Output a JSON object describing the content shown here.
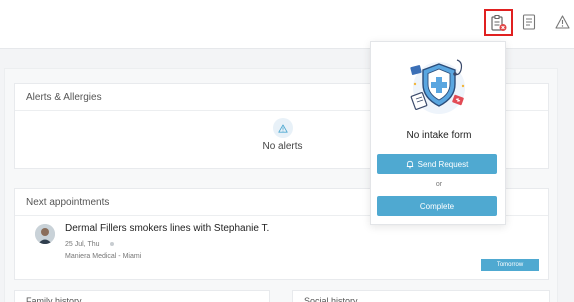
{
  "topbar": {
    "icons": [
      "intake-form-icon",
      "notes-icon",
      "warning-icon"
    ]
  },
  "alerts": {
    "title": "Alerts & Allergies",
    "empty_text": "No alerts"
  },
  "appointments": {
    "title": "Next appointments",
    "item": {
      "title": "Dermal Fillers smokers lines with Stephanie T.",
      "date": "25 Jul, Thu",
      "location": "Maniera Medical - Miami",
      "badge": "Tomorrow"
    }
  },
  "family_history": {
    "title": "Family history"
  },
  "social_history": {
    "title": "Social history"
  },
  "intake_popup": {
    "title": "No intake form",
    "send_label": "Send Request",
    "or_label": "or",
    "complete_label": "Complete"
  },
  "colors": {
    "accent": "#4fa9d1",
    "highlight": "#e02020"
  }
}
